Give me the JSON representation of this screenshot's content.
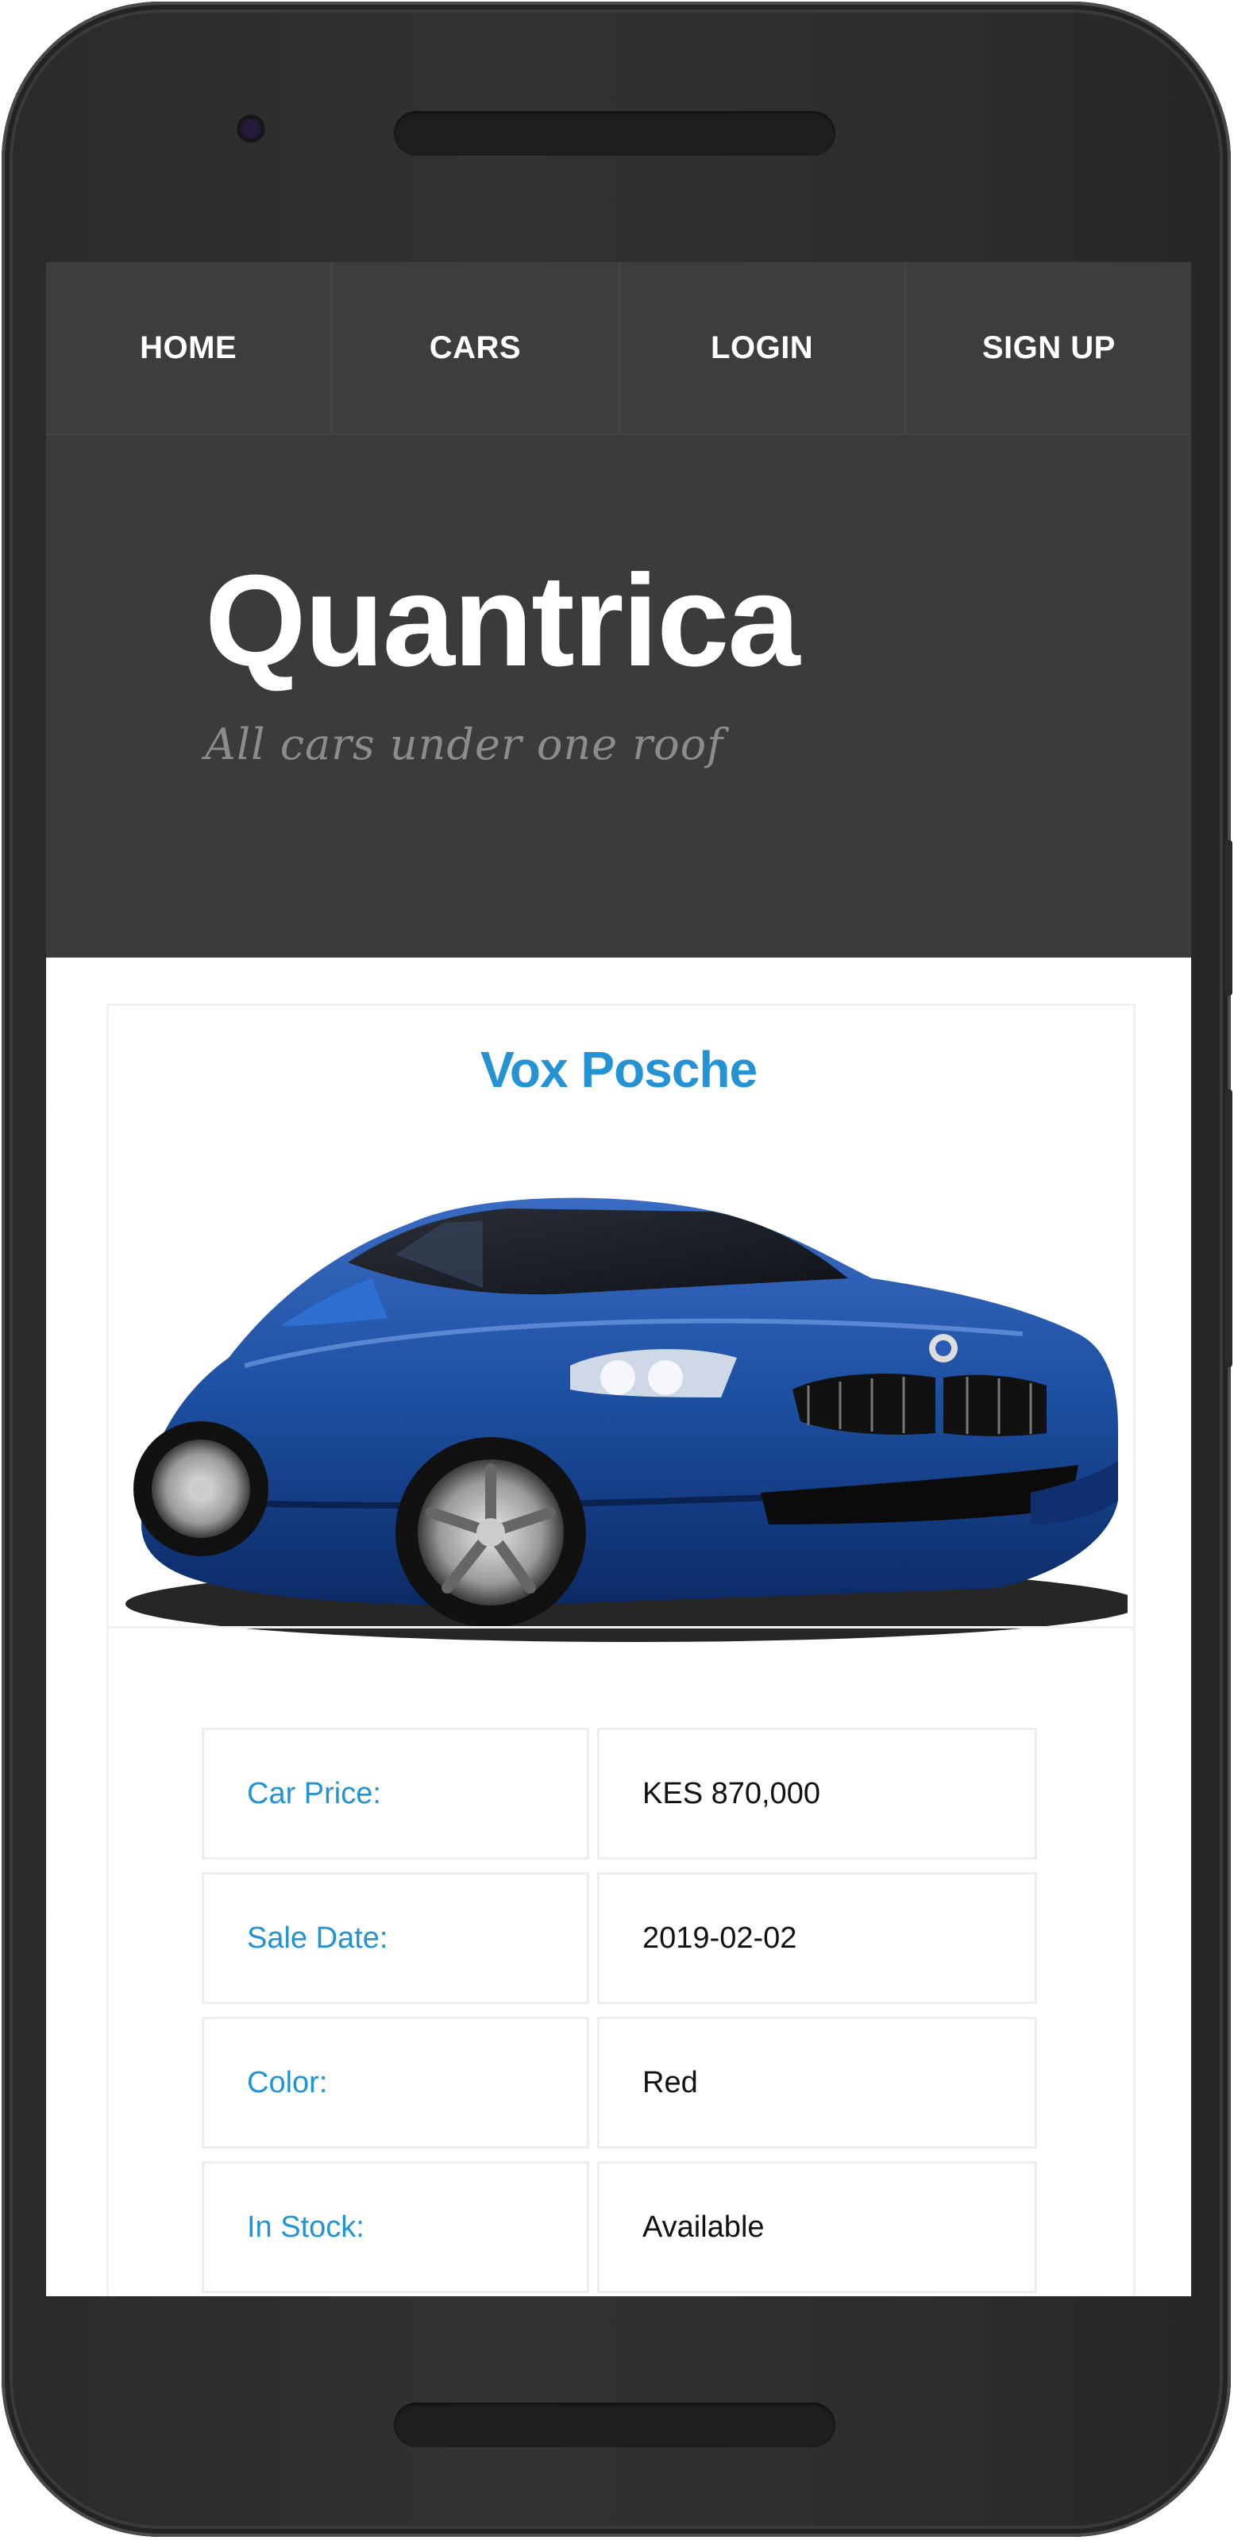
{
  "nav": {
    "items": [
      "HOME",
      "CARS",
      "LOGIN",
      "SIGN UP"
    ]
  },
  "header": {
    "brand": "Quantrica",
    "tagline": "All cars under one roof"
  },
  "car": {
    "title": "Vox Posche",
    "image_icon": "car-photo",
    "details": [
      {
        "label": "Car Price:",
        "value": "KES 870,000"
      },
      {
        "label": "Sale Date:",
        "value": "2019-02-02"
      },
      {
        "label": "Color:",
        "value": "Red"
      },
      {
        "label": "In Stock:",
        "value": "Available"
      }
    ]
  },
  "colors": {
    "header_bg": "#3b3b3b",
    "accent": "#2393d4",
    "car_body": "#1c4fa0"
  }
}
